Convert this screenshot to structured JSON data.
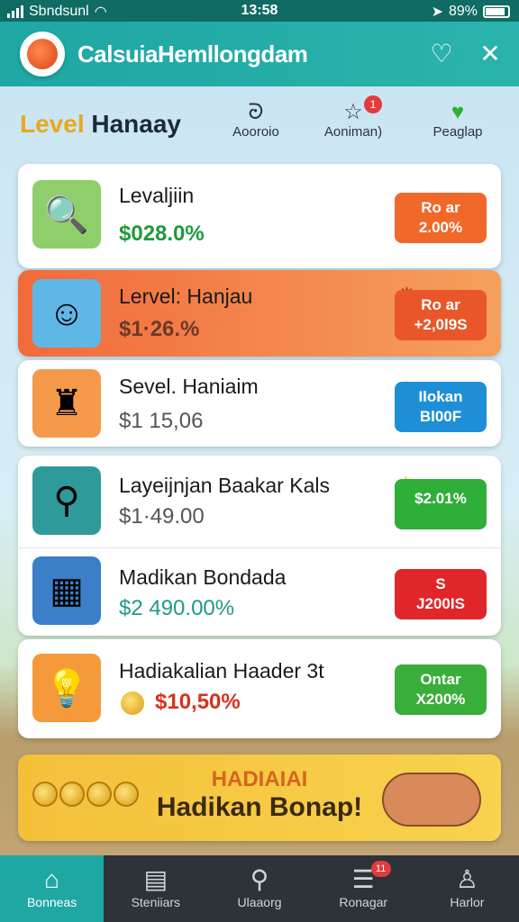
{
  "status_bar": {
    "carrier": "Sbndsunl",
    "time": "13:58",
    "battery": "89%"
  },
  "header": {
    "title": "CalsuiaHemllongdam"
  },
  "subheader": {
    "level_accent": "Level",
    "level_rest": " Hanaay",
    "quick": [
      {
        "label": "Aooroio",
        "icon": "swirl-icon"
      },
      {
        "label": "Aoniman)",
        "icon": "star-outline-icon",
        "badge": "1"
      },
      {
        "label": "Peaglap",
        "icon": "heart-icon"
      }
    ]
  },
  "items": [
    {
      "title": "Levaljiin",
      "value": "$028.0%",
      "value_color": "#1f9a3a",
      "badge_l1": "Ro ar",
      "badge_l2": "2.00%",
      "badge_color": "#f0682a",
      "thumb_color": "#8fcf6b",
      "thumb_icon": "magnifier-check-icon"
    },
    {
      "title": "Lervel: Hanjau",
      "value": "$1·26.%",
      "value_color": "#6a3a2a",
      "badge_l1": "Ro ar",
      "badge_l2": "+2,0l9S",
      "badge_color": "#e9562a",
      "thumb_color": "#5fb7e6",
      "thumb_icon": "character-face-icon"
    },
    {
      "title": "Sevel. Haniaim",
      "value": "$1 15,06",
      "value_color": "#555555",
      "badge_l1": "Ilokan",
      "badge_l2": "Bl00F",
      "badge_color": "#1e8fd6",
      "thumb_color": "#f59a4a",
      "thumb_icon": "treasure-bag-icon"
    },
    {
      "title": "Layeijnjan Baakar Kals",
      "value": "$1·49.00",
      "value_color": "#555555",
      "badge_l1": "$2.01%",
      "badge_l2": "",
      "badge_color": "#2fae3a",
      "thumb_color": "#2f9a9a",
      "thumb_icon": "magnifier-leaf-icon"
    },
    {
      "title": "Madikan Bondada",
      "value": "$2 490.00%",
      "value_color": "#1f9a8a",
      "badge_l1": "S",
      "badge_l2": "J200IS",
      "badge_color": "#e0262a",
      "thumb_color": "#3a7fc8",
      "thumb_icon": "calendar-grid-icon"
    },
    {
      "title": "Hadiakalian Haader 3t",
      "value": "$10,50%",
      "value_color": "#d7321a",
      "badge_l1": "Ontar",
      "badge_l2": "X200%",
      "badge_color": "#3aae3a",
      "thumb_color": "#f59a3a",
      "thumb_icon": "lightbulb-icon"
    }
  ],
  "banner": {
    "line1": "HADIAIAI",
    "line2": "Hadikan Bonap!"
  },
  "nav": [
    {
      "label": "Bonneas",
      "icon": "home-icon",
      "active": true
    },
    {
      "label": "Steniiars",
      "icon": "stats-icon"
    },
    {
      "label": "Ulaaorg",
      "icon": "search-icon"
    },
    {
      "label": "Ronagar",
      "icon": "list-icon",
      "badge": "11"
    },
    {
      "label": "Harlor",
      "icon": "profile-icon"
    }
  ]
}
